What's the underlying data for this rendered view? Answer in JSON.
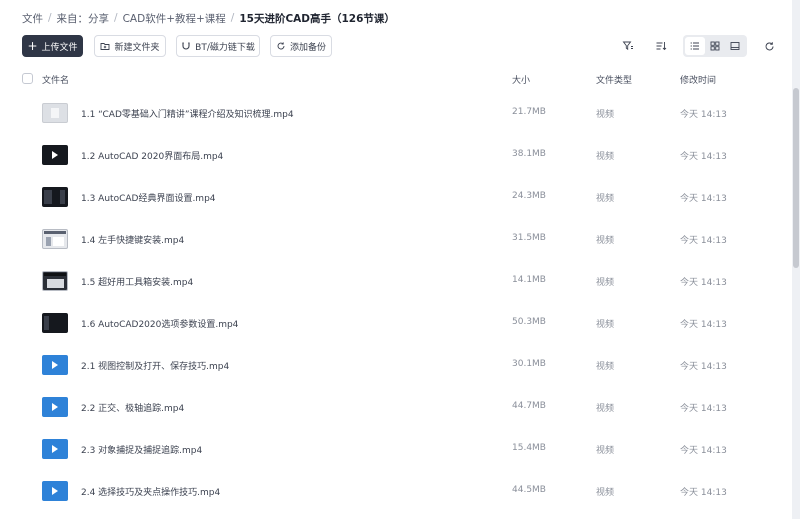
{
  "breadcrumb": {
    "items": [
      "文件",
      "来自：分享",
      "CAD软件+教程+课程"
    ],
    "current": "15天进阶CAD高手（126节课）"
  },
  "toolbar": {
    "upload_label": "上传文件",
    "new_folder_label": "新建文件夹",
    "bt_download_label": "BT/磁力链下载",
    "add_backup_label": "添加备份"
  },
  "table": {
    "columns": {
      "name": "文件名",
      "size": "大小",
      "type": "文件类型",
      "time": "修改时间"
    },
    "rows": [
      {
        "name": "1.1 “CAD零基础入门精讲”课程介绍及知识梳理.mp4",
        "size": "21.7MB",
        "type": "视频",
        "time": "今天 14:13",
        "thumb": "light"
      },
      {
        "name": "1.2 AutoCAD 2020界面布局.mp4",
        "size": "38.1MB",
        "type": "视频",
        "time": "今天 14:13",
        "thumb": "dark-play"
      },
      {
        "name": "1.3 AutoCAD经典界面设置.mp4",
        "size": "24.3MB",
        "type": "视频",
        "time": "今天 14:13",
        "thumb": "dark-strip"
      },
      {
        "name": "1.4 左手快捷键安装.mp4",
        "size": "31.5MB",
        "type": "视频",
        "time": "今天 14:13",
        "thumb": "screenshot"
      },
      {
        "name": "1.5 超好用工具箱安装.mp4",
        "size": "14.1MB",
        "type": "视频",
        "time": "今天 14:13",
        "thumb": "screenshot-dark"
      },
      {
        "name": "1.6 AutoCAD2020选项参数设置.mp4",
        "size": "50.3MB",
        "type": "视频",
        "time": "今天 14:13",
        "thumb": "dark-strip"
      },
      {
        "name": "2.1 视图控制及打开、保存技巧.mp4",
        "size": "30.1MB",
        "type": "视频",
        "time": "今天 14:13",
        "thumb": "video-icon"
      },
      {
        "name": "2.2 正交、极轴追踪.mp4",
        "size": "44.7MB",
        "type": "视频",
        "time": "今天 14:13",
        "thumb": "video-icon"
      },
      {
        "name": "2.3 对象捕捉及捕捉追踪.mp4",
        "size": "15.4MB",
        "type": "视频",
        "time": "今天 14:13",
        "thumb": "video-icon"
      },
      {
        "name": "2.4 选择技巧及夹点操作技巧.mp4",
        "size": "44.5MB",
        "type": "视频",
        "time": "今天 14:13",
        "thumb": "video-icon"
      }
    ]
  },
  "colors": {
    "primary_button": "#2f3646",
    "video_icon": "#2e82d8"
  }
}
